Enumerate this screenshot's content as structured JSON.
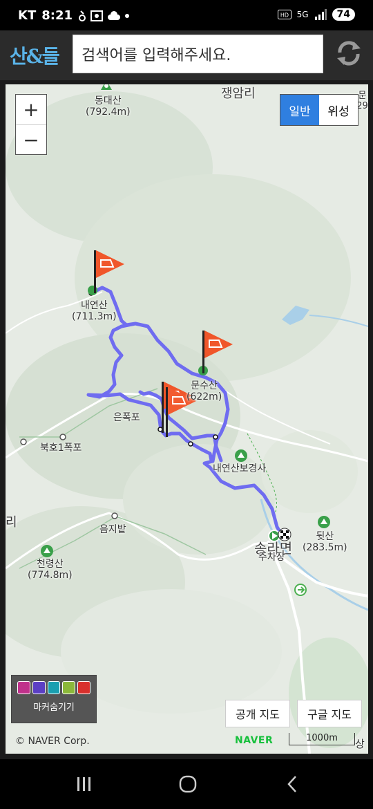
{
  "status": {
    "carrier": "KT",
    "time": "8:21",
    "battery": "74",
    "network": "5G"
  },
  "header": {
    "logo_text": "산&들",
    "search_placeholder": "검색어를 입력해주세요.",
    "refresh_icon": "refresh-icon"
  },
  "map": {
    "zoom_in": "+",
    "zoom_out": "−",
    "map_type": {
      "normal": "일반",
      "satellite": "위성",
      "selected": "normal"
    },
    "labels": {
      "village1": "쟁암리",
      "mountain1": "동대산",
      "mountain1_elev": "(792.4m)",
      "mountain2": "내연산",
      "mountain2_elev": "(711.3m)",
      "mountain3": "문수산",
      "mountain3_elev": "(622m)",
      "waterfall1": "은폭포",
      "waterfall2": "북호1폭포",
      "temple": "내연산보경사",
      "field": "음지밭",
      "mountain4": "천령산",
      "mountain4_elev": "(774.8m)",
      "mountain5": "뒷산",
      "mountain5_elev": "(283.5m)",
      "town": "송라면",
      "parking": "주차장",
      "edge_right_top": "문 29",
      "edge_left": "리",
      "edge_bottom_right": "상"
    },
    "marker_toggle": "마커숨기기",
    "buttons": {
      "public_map": "공개 지도",
      "google_map": "구글 지도"
    },
    "copyright": "© NAVER Corp.",
    "naver_logo": "NAVER",
    "scale": "1000m",
    "colors": {
      "route": "#6f6cf0",
      "flag": "#f0562a",
      "water": "#a9cfe8",
      "road": "#ffffff",
      "accent": "#2f7fe0"
    }
  }
}
